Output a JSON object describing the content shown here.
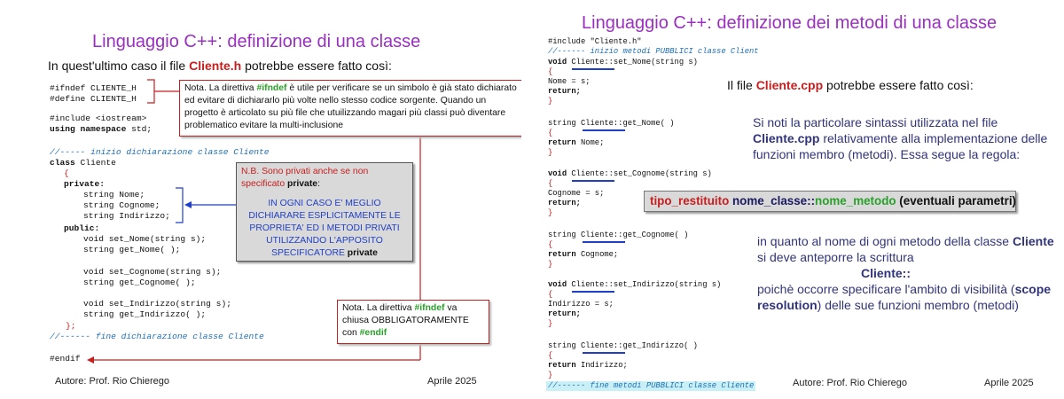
{
  "left": {
    "title": "Linguaggio C++: definizione di una classe",
    "intro_pre": "In quest'ultimo caso il file ",
    "intro_file": "Cliente.h",
    "intro_post": " potrebbe essere fatto così:",
    "code": {
      "ifndef": "#ifndef CLIENTE_H",
      "define": "#define CLIENTE_H",
      "include": "#include <iostream>",
      "using_kw": "using namespace",
      "using_rest": " std;",
      "comment_start": "//----- inizio dichiarazione classe Cliente",
      "class_kw": "class",
      "class_name": " Cliente",
      "open_brace": "{",
      "private": "private:",
      "nome": "string Nome;",
      "cognome": "string Cognome;",
      "indirizzo": "string Indirizzo;",
      "public": "public:",
      "set_nome": "void set_Nome(string s);",
      "get_nome": "string get_Nome( );",
      "set_cognome": "void set_Cognome(string s);",
      "get_cognome": "string get_Cognome( );",
      "set_indirizzo": "void set_Indirizzo(string s);",
      "get_indirizzo": "string get_Indirizzo( );",
      "close_brace": "};",
      "comment_end": "//------ fine dichiarazione classe Cliente",
      "endif": "#endif"
    },
    "note1": {
      "p1": "Nota. La direttiva ",
      "kw": "#ifndef",
      "p2": " è utile per verificare se un simbolo è già stato dichiarato ed evitare di dichiararlo più volte nello stesso codice sorgente. Quando un progetto è articolato su più file che utuilizzando magari più classi può diventare problematico  evitare la multi-inclusione"
    },
    "note2": {
      "line1a": "N.B. Sono privati anche se non specificato ",
      "line1b": "private",
      "line1c": ":",
      "body": "IN OGNI CASO  E' MEGLIO DICHIARARE ESPLICITAMENTE  LE PROPRIETA' ED I METODI PRIVATI UTILIZZANDO L'APPOSITO SPECIFICATORE ",
      "body_kw": "private"
    },
    "note3": {
      "p1": "Nota. La direttiva ",
      "kw1": "#ifndef",
      "p2": " va chiusa OBBLIGATORAMENTE con ",
      "kw2": "#endif"
    },
    "footer_author": "Autore: Prof. Rio Chierego",
    "footer_date": "Aprile 2025"
  },
  "right": {
    "title": "Linguaggio C++: definizione dei metodi di una classe",
    "code": {
      "include": "#include \"Cliente.h\"",
      "comment_start": "//------ inizio metodi PUBBLICI classe Client",
      "m1_sig_a": "void",
      "m1_sig_b": " Cliente::set_Nome(string s)",
      "m1_body": "Nome = s;",
      "m2_sig_a": "string Cliente::get_Nome( )",
      "m2_body_a": "return",
      "m2_body_b": " Nome;",
      "m3_sig_a": "void",
      "m3_sig_b": " Cliente::set_Cognome(string s)",
      "m3_body": "Cognome = s;",
      "m4_sig_a": "string Cliente::get_Cognome( )",
      "m4_body_b": " Cognome;",
      "m5_sig_a": "void",
      "m5_sig_b": " Cliente::set_Indirizzo(string s)",
      "m5_body": "Indirizzo = s;",
      "m6_sig_a": "string Cliente::get_Indirizzo( )",
      "m6_body_b": " Indirizzo;",
      "open": "{",
      "close": "}",
      "ret": "return;",
      "ret_kw": "return",
      "comment_end": "//------ fine metodi PUBBLICI classe Cliente"
    },
    "file_pre": "Il file ",
    "file_name": "Cliente.cpp",
    "file_post": " potrebbe essere fatto così:",
    "para1_a": "Si noti la particolare sintassi utilizzata nel file ",
    "para1_b": "Cliente.cpp",
    "para1_c": " relativamente alla implementazione delle funzioni membro (metodi). Essa segue la regola:",
    "rule_a": "tipo_restituito",
    "rule_b": " nome_classe::",
    "rule_c": "nome_metodo",
    "rule_d": " (eventuali parametri)",
    "para2_a": "in quanto al nome di ogni metodo della classe ",
    "para2_b": "Cliente",
    "para2_c": " si deve anteporre la scrittura",
    "para2_d": "Cliente::",
    "para2_e": "poichè occorre specificare l'ambito di visibilità (",
    "para2_f": "scope resolution",
    "para2_g": ") delle sue funzioni membro (metodi)",
    "footer_author": "Autore: Prof. Rio Chierego",
    "footer_date": "Aprile 2025"
  }
}
